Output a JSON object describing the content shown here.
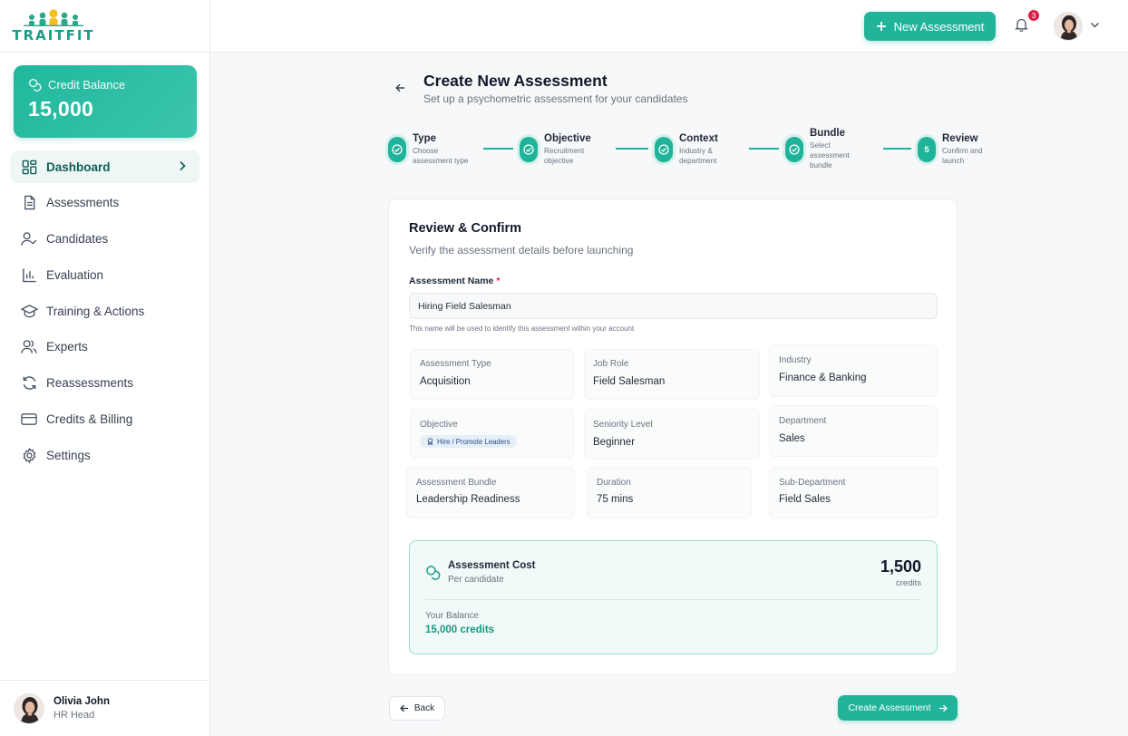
{
  "brand": {
    "logo_text": "TRAITFIT"
  },
  "colors": {
    "accent": "#22b49b",
    "accent_dark": "#0e5d52",
    "badge": "#e11d48"
  },
  "sidebar": {
    "credit": {
      "label": "Credit Balance",
      "value": "15,000"
    },
    "items": [
      {
        "label": "Dashboard",
        "icon": "dashboard-icon",
        "active": true
      },
      {
        "label": "Assessments",
        "icon": "document-icon"
      },
      {
        "label": "Candidates",
        "icon": "user-check-icon"
      },
      {
        "label": "Evaluation",
        "icon": "bar-chart-icon"
      },
      {
        "label": "Training & Actions",
        "icon": "graduation-cap-icon"
      },
      {
        "label": "Experts",
        "icon": "users-icon"
      },
      {
        "label": "Reassessments",
        "icon": "refresh-icon"
      },
      {
        "label": "Credits & Billing",
        "icon": "credit-card-icon"
      },
      {
        "label": "Settings",
        "icon": "gear-icon"
      }
    ],
    "user": {
      "name": "Olivia John",
      "role": "HR Head"
    }
  },
  "topbar": {
    "new_button": "New Assessment",
    "notification_count": "3"
  },
  "page": {
    "title": "Create New Assessment",
    "subtitle": "Set up a psychometric assessment for your candidates"
  },
  "steps": [
    {
      "title": "Type",
      "desc": "Choose assessment type",
      "status": "done"
    },
    {
      "title": "Objective",
      "desc": "Recruitment objective",
      "status": "done"
    },
    {
      "title": "Context",
      "desc": "Industry & department",
      "status": "done"
    },
    {
      "title": "Bundle",
      "desc": "Select assessment bundle",
      "status": "done"
    },
    {
      "title": "Review",
      "desc": "Confirm and launch",
      "number": "5",
      "status": "current"
    }
  ],
  "review": {
    "title": "Review & Confirm",
    "subtitle": "Verify the assessment details before launching",
    "name_label": "Assessment Name",
    "required_mark": "*",
    "name_value": "Hiring Field Salesman",
    "name_hint": "This name will be used to identify this assessment within your account",
    "details": {
      "assessment_type": {
        "label": "Assessment Type",
        "value": "Acquisition"
      },
      "job_role": {
        "label": "Job Role",
        "value": "Field Salesman"
      },
      "industry": {
        "label": "Industry",
        "value": "Finance & Banking"
      },
      "objective": {
        "label": "Objective",
        "value": "Hire / Promote Leaders"
      },
      "seniority": {
        "label": "Seniority Level",
        "value": "Beginner"
      },
      "department": {
        "label": "Department",
        "value": "Sales"
      },
      "bundle": {
        "label": "Assessment Bundle",
        "value": "Leadership Readiness"
      },
      "duration": {
        "label": "Duration",
        "value": "75 mins"
      },
      "sub_department": {
        "label": "Sub-Department",
        "value": "Field Sales"
      }
    },
    "cost": {
      "title": "Assessment Cost",
      "subtitle": "Per candidate",
      "value": "1,500",
      "unit": "credits",
      "balance_label": "Your Balance",
      "balance_value": "15,000 credits"
    }
  },
  "actions": {
    "back": "Back",
    "create": "Create Assessment"
  }
}
